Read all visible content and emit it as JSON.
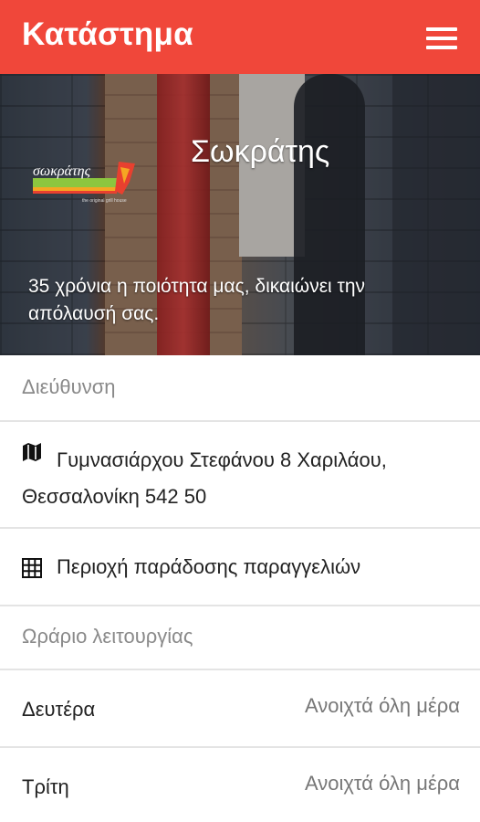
{
  "appbar": {
    "title": "Κατάστημα",
    "menu_icon": "hamburger-menu-icon",
    "color": "#f0473a"
  },
  "hero": {
    "store_name": "Σωκράτης",
    "tagline": "35 χρόνια η ποιότητα μας, δικαιώνει την απόλαυσή σας.",
    "logo_text": "σωκράτης",
    "logo_subtext": "the original grill house"
  },
  "address": {
    "section_title": "Διεύθυνση",
    "icon": "map-icon",
    "value": "Γυμνασιάρχου Στεφάνου 8 Χαριλάου, Θεσσαλονίκη 542 50"
  },
  "delivery_area": {
    "icon": "grid-icon",
    "label": "Περιοχή παράδοσης παραγγελιών"
  },
  "hours": {
    "section_title": "Ωράριο λειτουργίας",
    "days": [
      {
        "day": "Δευτέρα",
        "status": "Ανοιχτά όλη μέρα"
      },
      {
        "day": "Τρίτη",
        "status": "Ανοιχτά όλη μέρα"
      }
    ]
  }
}
